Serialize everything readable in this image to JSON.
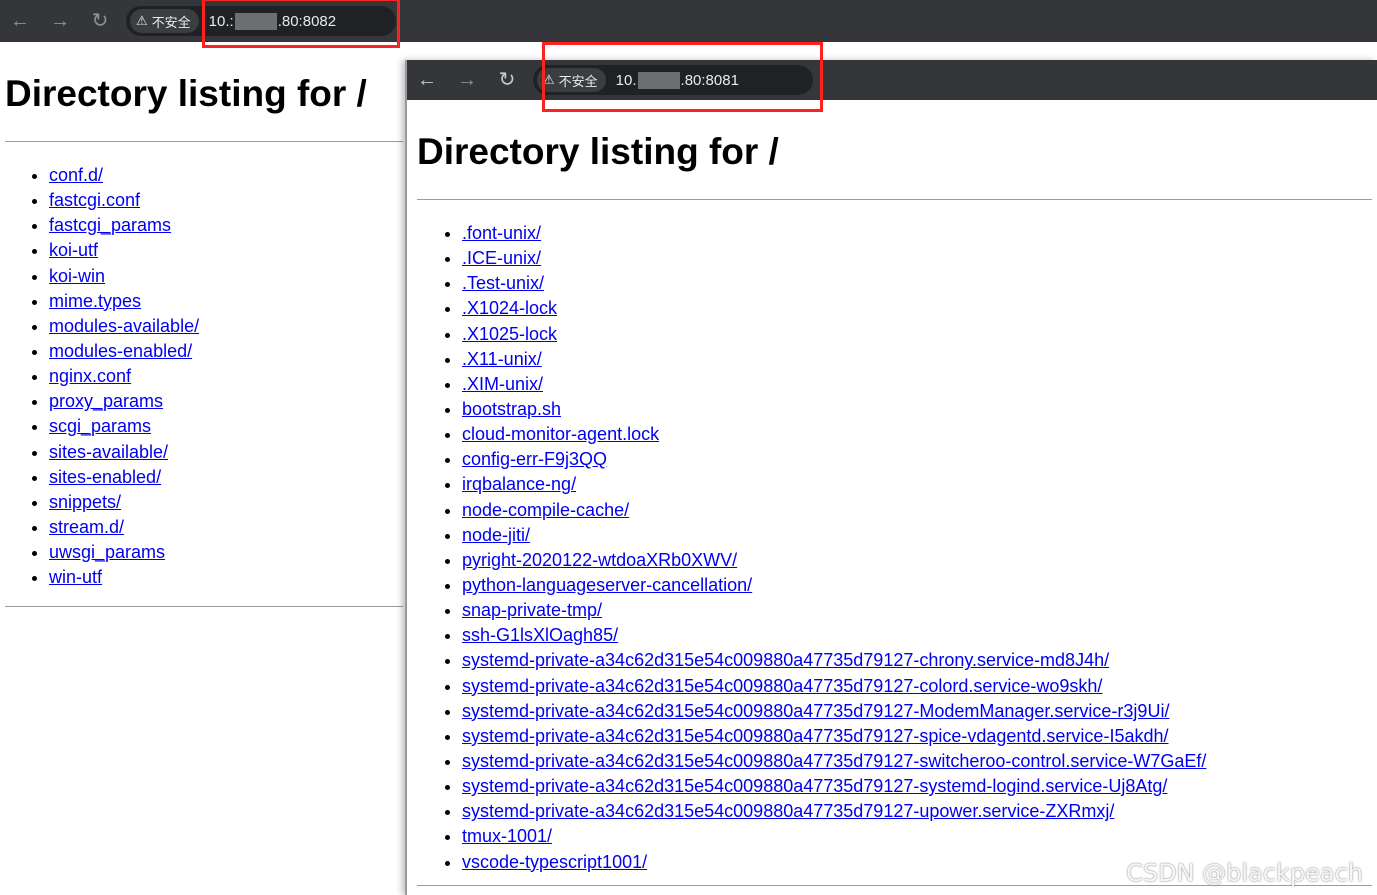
{
  "back_window": {
    "security_label": "不安全",
    "url_prefix": "10.:",
    "url_suffix": ".80:8082",
    "heading": "Directory listing for /",
    "entries": [
      "conf.d/",
      "fastcgi.conf",
      "fastcgi_params",
      "koi-utf",
      "koi-win",
      "mime.types",
      "modules-available/",
      "modules-enabled/",
      "nginx.conf",
      "proxy_params",
      "scgi_params",
      "sites-available/",
      "sites-enabled/",
      "snippets/",
      "stream.d/",
      "uwsgi_params",
      "win-utf"
    ]
  },
  "front_window": {
    "security_label": "不安全",
    "url_prefix": "10.",
    "url_suffix": ".80:8081",
    "heading": "Directory listing for /",
    "entries": [
      ".font-unix/",
      ".ICE-unix/",
      ".Test-unix/",
      ".X1024-lock",
      ".X1025-lock",
      ".X11-unix/",
      ".XIM-unix/",
      "bootstrap.sh",
      "cloud-monitor-agent.lock",
      "config-err-F9j3QQ",
      "irqbalance-ng/",
      "node-compile-cache/",
      "node-jiti/",
      "pyright-2020122-wtdoaXRb0XWV/",
      "python-languageserver-cancellation/",
      "snap-private-tmp/",
      "ssh-G1lsXlOagh85/",
      "systemd-private-a34c62d315e54c009880a47735d79127-chrony.service-md8J4h/",
      "systemd-private-a34c62d315e54c009880a47735d79127-colord.service-wo9skh/",
      "systemd-private-a34c62d315e54c009880a47735d79127-ModemManager.service-r3j9Ui/",
      "systemd-private-a34c62d315e54c009880a47735d79127-spice-vdagentd.service-I5akdh/",
      "systemd-private-a34c62d315e54c009880a47735d79127-switcheroo-control.service-W7GaEf/",
      "systemd-private-a34c62d315e54c009880a47735d79127-systemd-logind.service-Uj8Atg/",
      "systemd-private-a34c62d315e54c009880a47735d79127-upower.service-ZXRmxj/",
      "tmux-1001/",
      "vscode-typescript1001/"
    ]
  },
  "icons": {
    "back": "←",
    "forward": "→",
    "reload": "↻",
    "warning": "⚠"
  },
  "watermark": "CSDN @blackpeach",
  "colors": {
    "toolbar": "#35363a",
    "link": "#0000ee",
    "highlight": "#ff2020"
  }
}
